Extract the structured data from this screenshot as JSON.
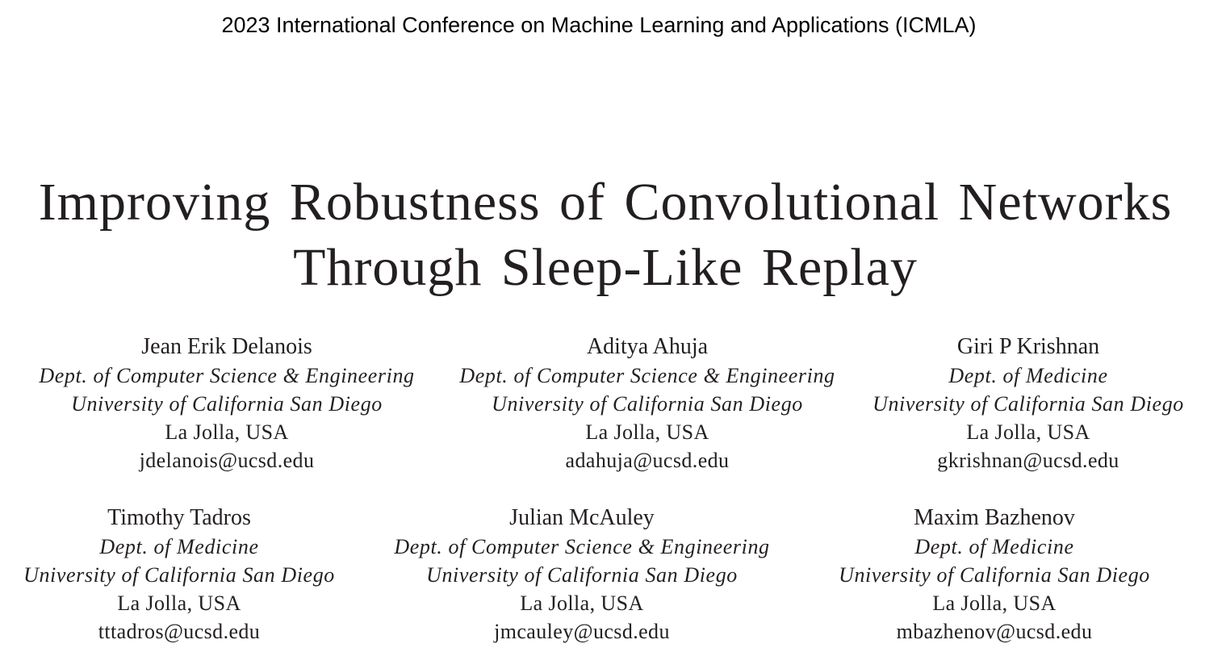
{
  "header": {
    "conference": "2023 International Conference on Machine Learning and Applications (ICMLA)"
  },
  "paper": {
    "title_line1": "Improving Robustness of Convolutional Networks",
    "title_line2": "Through Sleep-Like Replay"
  },
  "authors": [
    {
      "name": "Jean Erik Delanois",
      "dept": "Dept. of Computer Science & Engineering",
      "univ": "University of California San Diego",
      "location": "La Jolla, USA",
      "email": "jdelanois@ucsd.edu"
    },
    {
      "name": "Aditya Ahuja",
      "dept": "Dept. of Computer Science & Engineering",
      "univ": "University of California San Diego",
      "location": "La Jolla, USA",
      "email": "adahuja@ucsd.edu"
    },
    {
      "name": "Giri P Krishnan",
      "dept": "Dept. of Medicine",
      "univ": "University of California San Diego",
      "location": "La Jolla, USA",
      "email": "gkrishnan@ucsd.edu"
    },
    {
      "name": "Timothy Tadros",
      "dept": "Dept. of Medicine",
      "univ": "University of California San Diego",
      "location": "La Jolla, USA",
      "email": "tttadros@ucsd.edu"
    },
    {
      "name": "Julian McAuley",
      "dept": "Dept. of Computer Science & Engineering",
      "univ": "University of California San Diego",
      "location": "La Jolla, USA",
      "email": "jmcauley@ucsd.edu"
    },
    {
      "name": "Maxim Bazhenov",
      "dept": "Dept. of Medicine",
      "univ": "University of California San Diego",
      "location": "La Jolla, USA",
      "email": "mbazhenov@ucsd.edu"
    }
  ]
}
